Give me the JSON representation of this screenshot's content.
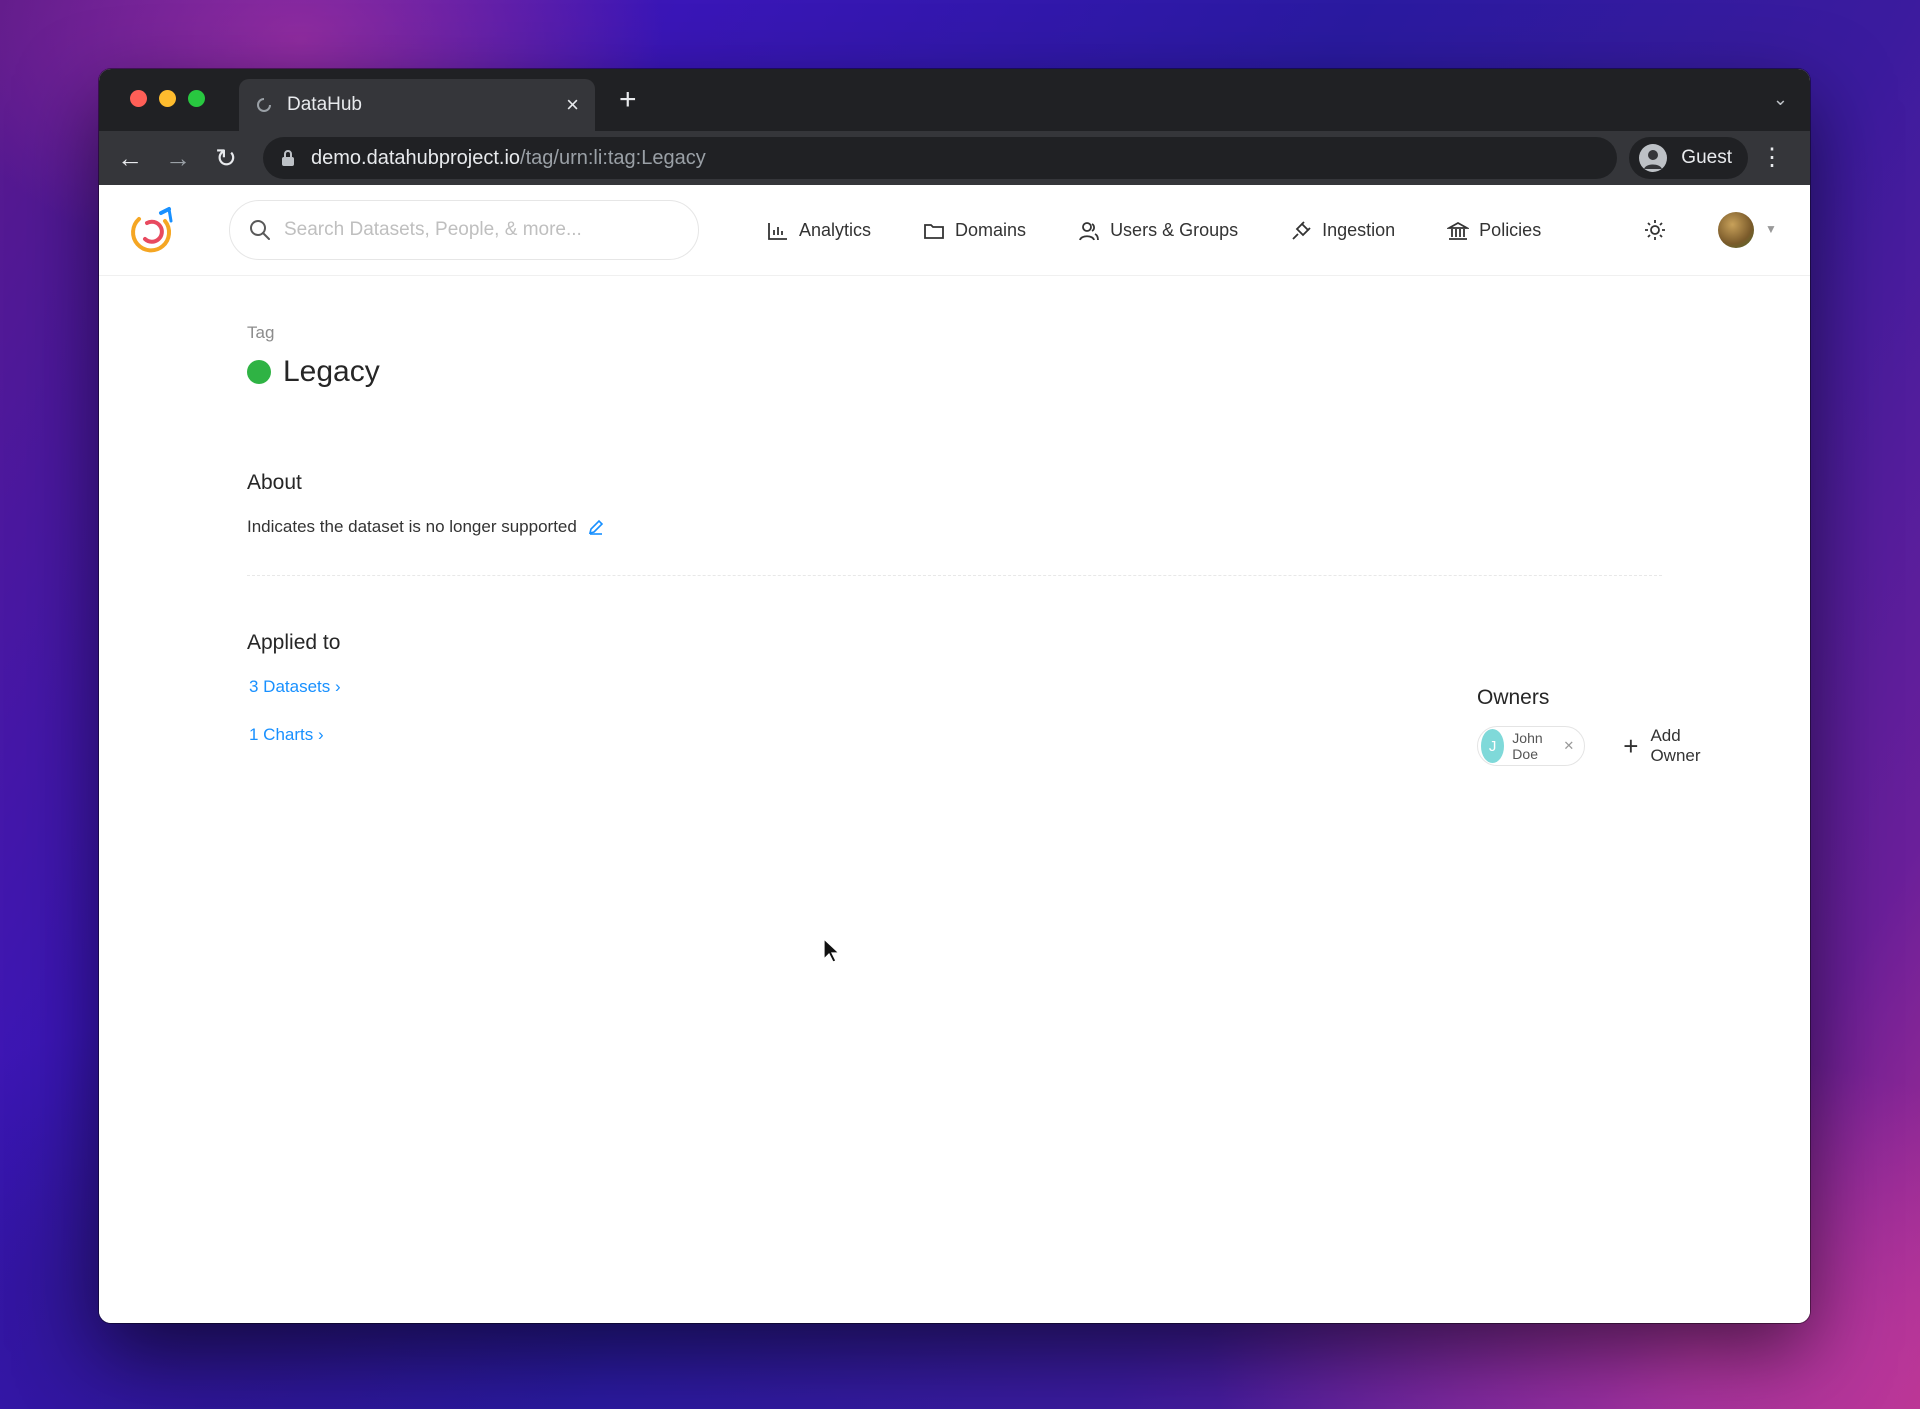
{
  "browser": {
    "tab_title": "DataHub",
    "url_host": "demo.datahubproject.io",
    "url_path": "/tag/urn:li:tag:Legacy",
    "profile_label": "Guest"
  },
  "header": {
    "search_placeholder": "Search Datasets, People, & more...",
    "nav": [
      {
        "label": "Analytics",
        "icon": "analytics-icon"
      },
      {
        "label": "Domains",
        "icon": "folder-icon"
      },
      {
        "label": "Users & Groups",
        "icon": "users-icon"
      },
      {
        "label": "Ingestion",
        "icon": "plug-icon"
      },
      {
        "label": "Policies",
        "icon": "bank-icon"
      }
    ]
  },
  "entity": {
    "type": "Tag",
    "name": "Legacy",
    "color": "#2fb344",
    "about_heading": "About",
    "description": "Indicates the dataset is no longer supported"
  },
  "applied": {
    "heading": "Applied to",
    "links": [
      "3 Datasets ›",
      "1 Charts ›"
    ]
  },
  "owners": {
    "heading": "Owners",
    "list": [
      {
        "initial": "J",
        "name": "John Doe"
      }
    ],
    "add_label": "Add Owner"
  }
}
